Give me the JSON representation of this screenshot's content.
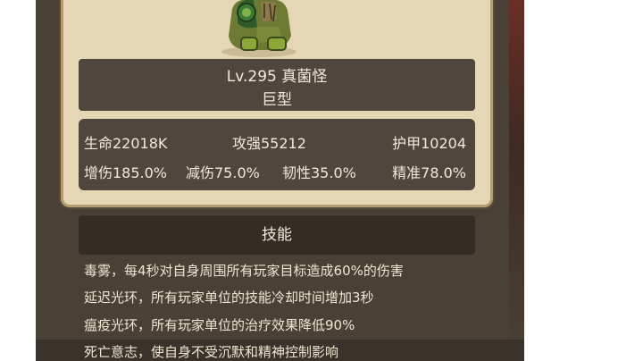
{
  "monster": {
    "level_name": "Lv.295 真菌怪",
    "size": "巨型"
  },
  "stats": {
    "hp": "生命22018K",
    "attack": "攻强55212",
    "armor": "护甲10204",
    "dmg_up": "增伤185.0%",
    "dmg_down": "减伤75.0%",
    "toughness": "韧性35.0%",
    "accuracy": "精准78.0%"
  },
  "skills": {
    "header": "技能",
    "lines": [
      "毒雾，每4秒对自身周围所有玩家目标造成60%的伤害",
      "延迟光环，所有玩家单位的技能冷却时间增加3秒",
      "瘟疫光环，所有玩家单位的治疗效果降低90%",
      "死亡意志，使自身不受沉默和精神控制影响"
    ]
  },
  "colors": {
    "panel_dark": "#4f463e",
    "parchment": "#e5d7b6",
    "text_light": "#f2ead9"
  }
}
